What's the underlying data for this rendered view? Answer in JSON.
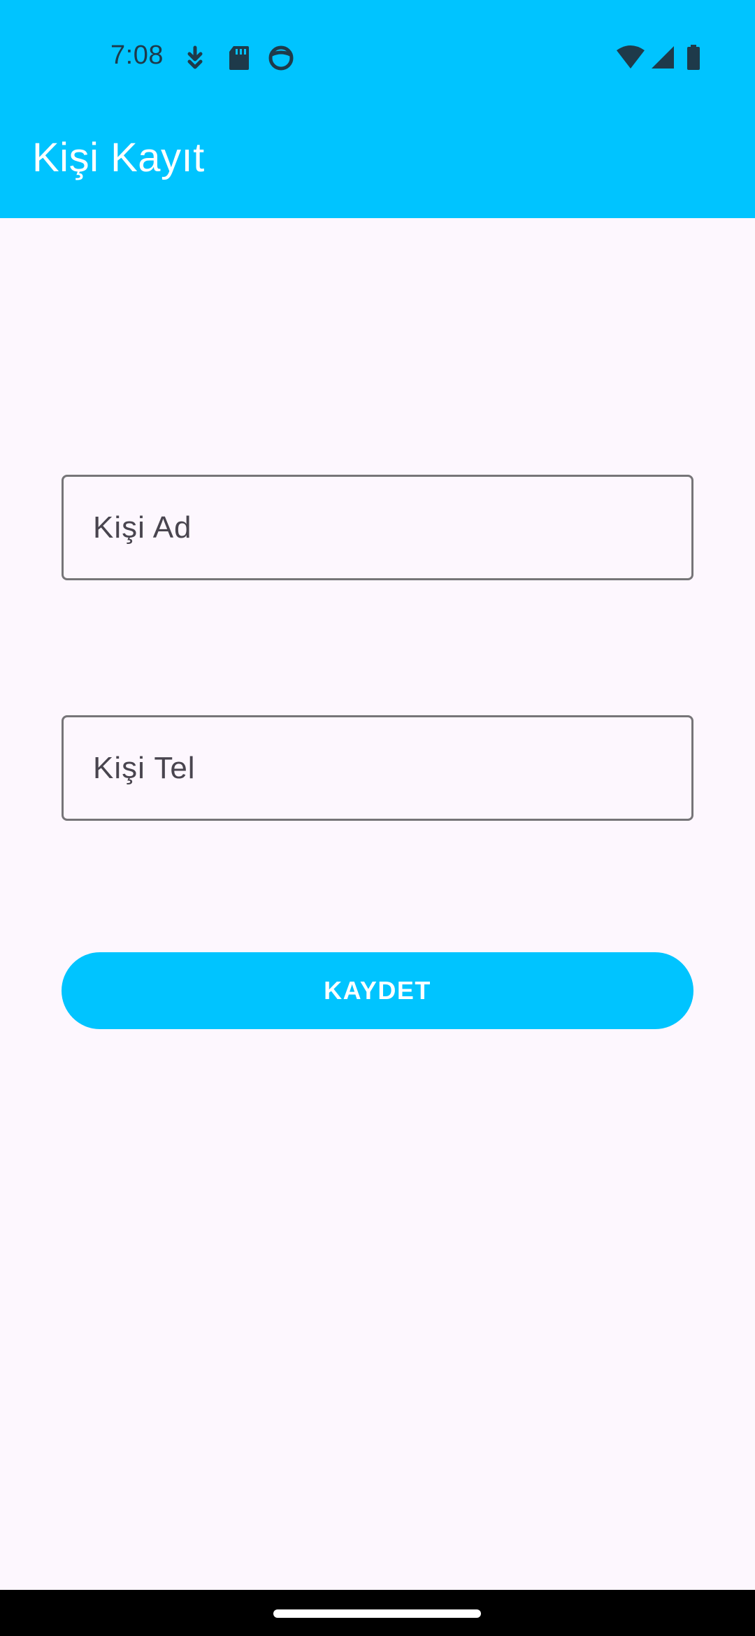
{
  "status_bar": {
    "time": "7:08",
    "left_icons": [
      "download-icon",
      "sd-card-icon",
      "face-icon"
    ],
    "right_icons": [
      "wifi-icon",
      "signal-icon",
      "battery-icon"
    ]
  },
  "app_bar": {
    "title": "Kişi Kayıt"
  },
  "form": {
    "name_placeholder": "Kişi Ad",
    "name_value": "",
    "phone_placeholder": "Kişi Tel",
    "phone_value": "",
    "save_label": "KAYDET"
  },
  "colors": {
    "accent": "#00C4FF",
    "background": "#FDF7FE",
    "field_border": "#767578",
    "status_icons": "#1E3A4A"
  }
}
